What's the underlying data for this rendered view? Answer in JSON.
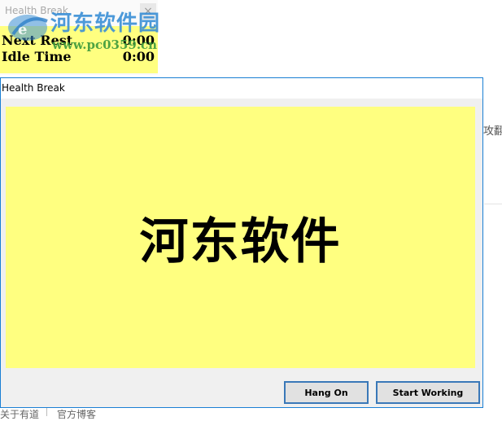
{
  "mini_window": {
    "title": "Health Break",
    "close_glyph": "×",
    "rows": [
      {
        "label": "Next Rest",
        "value": "0:00"
      },
      {
        "label": "Idle Time",
        "value": "0:00"
      }
    ]
  },
  "watermark": {
    "title": "河东软件园",
    "url": "www.pc0359.cn"
  },
  "dialog": {
    "title": "Health Break",
    "message": "河东软件",
    "buttons": {
      "hang_on": "Hang On",
      "start_working": "Start Working"
    }
  },
  "background": {
    "side_text": "攻翻",
    "bottom_links": [
      "关于有道",
      "官方博客"
    ]
  },
  "colors": {
    "panel_yellow": "#ffff80",
    "accent_blue": "#1a7fd4"
  }
}
